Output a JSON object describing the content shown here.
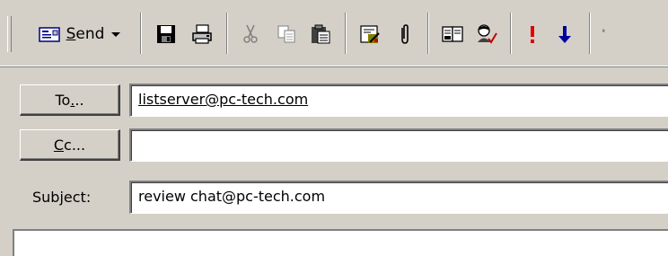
{
  "toolbar": {
    "send_label_underlined": "S",
    "send_label_rest": "end",
    "icons": [
      "envelope-send-icon",
      "save-icon",
      "print-icon",
      "cut-icon",
      "copy-icon",
      "paste-icon",
      "check-names-icon",
      "attach-icon",
      "address-book-icon",
      "check-names-person-icon",
      "high-importance-icon",
      "low-importance-icon"
    ]
  },
  "header": {
    "to_button": {
      "pre": "To",
      "ul": ".",
      "post": ".."
    },
    "to_value": "listserver@pc-tech.com",
    "cc_button": {
      "ul": "C",
      "post": "c..."
    },
    "cc_value": "",
    "subject_label_pre": "Subject:",
    "subject_value": "review chat@pc-tech.com"
  },
  "colors": {
    "chrome": "#d4d0c8",
    "importance_high": "#e00000",
    "importance_low": "#0000a0"
  }
}
